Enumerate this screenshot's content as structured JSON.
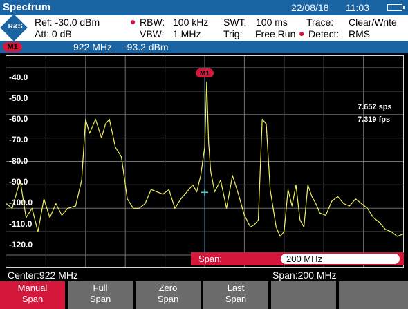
{
  "title": {
    "app": "Spectrum",
    "date": "22/08/18",
    "time": "11:03"
  },
  "icons": {
    "logo": "rohde-schwarz-logo",
    "battery": "battery-icon"
  },
  "settings": {
    "ref": "Ref: -30.0 dBm",
    "att": "Att: 0 dB",
    "rbw_label": "RBW:",
    "rbw_value": "100 kHz",
    "vbw_label": "VBW:",
    "vbw_value": "1 MHz",
    "swt_label": "SWT:",
    "swt_value": "100 ms",
    "trig_label": "Trig:",
    "trig_value": "Free Run",
    "trace_label": "Trace:",
    "trace_value": "Clear/Write",
    "detect_label": "Detect:",
    "detect_value": "RMS"
  },
  "marker": {
    "tag": "M1",
    "freq": "922  MHz",
    "level": "-93.2  dBm",
    "plot_label": "M1"
  },
  "plot": {
    "y_labels": [
      "-40.0",
      "-50.0",
      "-60.0",
      "-70.0",
      "-80.0",
      "-90.0",
      "-100.0",
      "-110.0",
      "-120.0"
    ],
    "rates": [
      "7.652 sps",
      "7.319 fps"
    ],
    "colors": {
      "trace": "#f2f262",
      "grid": "#6f6f6f",
      "marker": "#d6173c",
      "marker_line": "#4f8fb9"
    }
  },
  "span_panel": {
    "label": "Span:",
    "value": "200 MHz"
  },
  "bottom": {
    "center": "Center:922 MHz",
    "span": "Span:200 MHz"
  },
  "softkeys": [
    {
      "line1": "Manual",
      "line2": "Span",
      "active": true
    },
    {
      "line1": "Full",
      "line2": "Span",
      "active": false
    },
    {
      "line1": "Zero",
      "line2": "Span",
      "active": false
    },
    {
      "line1": "Last",
      "line2": "Span",
      "active": false
    },
    {
      "line1": "",
      "line2": "",
      "active": false
    },
    {
      "line1": "",
      "line2": "",
      "active": false
    }
  ],
  "chart_data": {
    "type": "line",
    "xlabel": "",
    "ylabel": "",
    "ylim": [
      -125,
      -35
    ],
    "x": [
      822,
      825,
      827,
      829,
      832,
      835,
      838,
      841,
      844,
      847,
      850,
      853,
      857,
      860,
      862,
      864,
      867,
      870,
      872,
      874,
      877,
      880,
      883,
      886,
      889,
      892,
      895,
      898,
      901,
      904,
      907,
      910,
      913,
      916,
      918,
      920,
      921,
      922,
      923,
      924,
      925,
      927,
      930,
      933,
      936,
      939,
      942,
      945,
      947,
      949,
      951,
      953,
      955,
      958,
      960,
      962,
      964,
      966,
      968,
      970,
      972,
      974,
      976,
      978,
      980,
      983,
      986,
      989,
      992,
      995,
      998,
      1001,
      1004,
      1007,
      1010,
      1013,
      1016,
      1019,
      1022
    ],
    "series": [
      {
        "values": [
          -98,
          -100,
          -94,
          -88,
          -104,
          -100,
          -110,
          -96,
          -104,
          -98,
          -103,
          -100,
          -99,
          -88,
          -62,
          -68,
          -62,
          -70,
          -64,
          -62,
          -74,
          -78,
          -96,
          -100,
          -100,
          -98,
          -92,
          -93,
          -94,
          -92,
          -100,
          -96,
          -93,
          -90,
          -93,
          -86,
          -80,
          -74,
          -46,
          -72,
          -84,
          -93,
          -88,
          -100,
          -86,
          -94,
          -103,
          -108,
          -107,
          -105,
          -62,
          -64,
          -92,
          -108,
          -112,
          -110,
          -92,
          -99,
          -90,
          -105,
          -108,
          -90,
          -95,
          -98,
          -102,
          -103,
          -97,
          -95,
          -98,
          -99,
          -96,
          -98,
          -100,
          -104,
          -106,
          -109,
          -110,
          -112,
          -111
        ]
      }
    ]
  }
}
